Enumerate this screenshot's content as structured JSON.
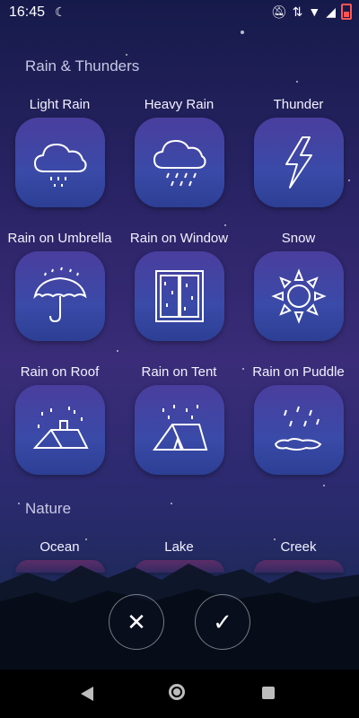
{
  "status_bar": {
    "time": "16:45"
  },
  "sections": [
    {
      "title": "Rain & Thunders",
      "items": [
        {
          "label": "Light Rain",
          "icon": "light-rain-icon"
        },
        {
          "label": "Heavy Rain",
          "icon": "heavy-rain-icon"
        },
        {
          "label": "Thunder",
          "icon": "thunder-icon"
        },
        {
          "label": "Rain on Umbrella",
          "icon": "umbrella-rain-icon"
        },
        {
          "label": "Rain on Window",
          "icon": "window-rain-icon"
        },
        {
          "label": "Snow",
          "icon": "snowflake-icon"
        },
        {
          "label": "Rain on Roof",
          "icon": "roof-rain-icon"
        },
        {
          "label": "Rain on Tent",
          "icon": "tent-rain-icon"
        },
        {
          "label": "Rain on Puddle",
          "icon": "puddle-rain-icon"
        }
      ]
    },
    {
      "title": "Nature",
      "items": [
        {
          "label": "Ocean",
          "icon": "ocean-icon"
        },
        {
          "label": "Lake",
          "icon": "lake-icon"
        },
        {
          "label": "Creek",
          "icon": "creek-icon"
        }
      ]
    }
  ],
  "actions": {
    "cancel_icon": "close-icon",
    "confirm_icon": "check-icon"
  },
  "colors": {
    "tile_top": "#4a3e9e",
    "tile_bottom": "#2c3f94",
    "section_title": "#c8c8e6"
  }
}
